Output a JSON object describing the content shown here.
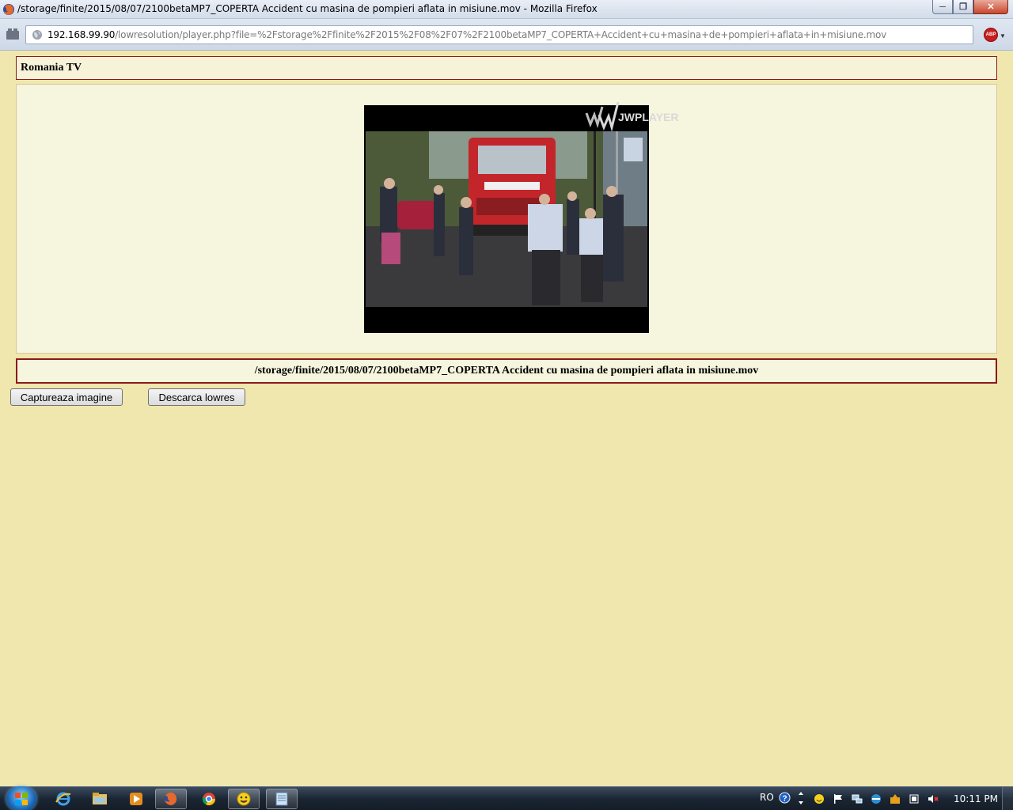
{
  "window": {
    "title": "/storage/finite/2015/08/07/2100betaMP7_COPERTA Accident cu masina de pompieri aflata in misiune.mov - Mozilla Firefox",
    "minimize_glyph": "─",
    "maximize_glyph": "❐",
    "close_glyph": "✕"
  },
  "navbar": {
    "url_host": "192.168.99.90",
    "url_path": "/lowresolution/player.php?file=%2Fstorage%2Ffinite%2F2015%2F08%2F07%2F2100betaMP7_COPERTA+Accident+cu+masina+de+pompieri+aflata+in+misiune.mov",
    "abp_label": "ABP"
  },
  "page": {
    "channel": "Romania TV",
    "player_logo": "JWPLAYER",
    "file_path": "/storage/finite/2015/08/07/2100betaMP7_COPERTA Accident cu masina de pompieri aflata in misiune.mov",
    "capture_button": "Captureaza imagine",
    "download_button": "Descarca lowres"
  },
  "taskbar": {
    "language": "RO",
    "clock": "10:11 PM",
    "apps": [
      "internet-explorer",
      "windows-explorer",
      "media-player",
      "firefox",
      "chrome",
      "messenger",
      "notepad"
    ]
  },
  "colors": {
    "page_bg": "#efe7ae",
    "box_border": "#8b1a1a",
    "box_bg": "#f6f5de"
  }
}
